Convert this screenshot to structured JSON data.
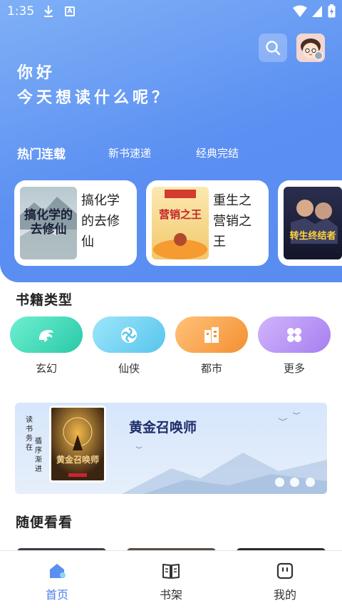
{
  "status_bar": {
    "time": "1:35",
    "a_icon_text": "A"
  },
  "header": {
    "greeting_line1": "你好",
    "greeting_line2": "今天想读什么呢？"
  },
  "tabs": [
    {
      "label": "热门连载",
      "active": true
    },
    {
      "label": "新书速递",
      "active": false
    },
    {
      "label": "经典完结",
      "active": false
    }
  ],
  "books": [
    {
      "title": "搞化学的去修仙",
      "cover_text": "搞化学的去修仙"
    },
    {
      "title": "重生之营销之王",
      "cover_text": "营销之王"
    },
    {
      "title": "",
      "cover_text": "转生终结者"
    }
  ],
  "categories_section": {
    "title": "书籍类型"
  },
  "categories": [
    {
      "label": "玄幻",
      "icon": "dragon-icon",
      "color": "#3fd6b4"
    },
    {
      "label": "仙侠",
      "icon": "swirl-icon",
      "color": "#6fd0f0"
    },
    {
      "label": "都市",
      "icon": "building-icon",
      "color": "#f5a14a"
    },
    {
      "label": "更多",
      "icon": "grid-icon",
      "color": "#b48cf2"
    }
  ],
  "banner": {
    "vertical_text_left": "读书务在",
    "vertical_text_right": "循序渐进",
    "title": "黄金召唤师",
    "cover_text": "黄金召唤师",
    "dots": 3
  },
  "random_section": {
    "title": "随便看看"
  },
  "bottom_nav": [
    {
      "label": "首页",
      "icon": "home-icon",
      "active": true
    },
    {
      "label": "书架",
      "icon": "book-icon",
      "active": false
    },
    {
      "label": "我的",
      "icon": "profile-icon",
      "active": false
    }
  ],
  "colors": {
    "primary": "#5b8ff2",
    "active_nav": "#4a7ff0",
    "banner_title": "#1e2c6a"
  }
}
